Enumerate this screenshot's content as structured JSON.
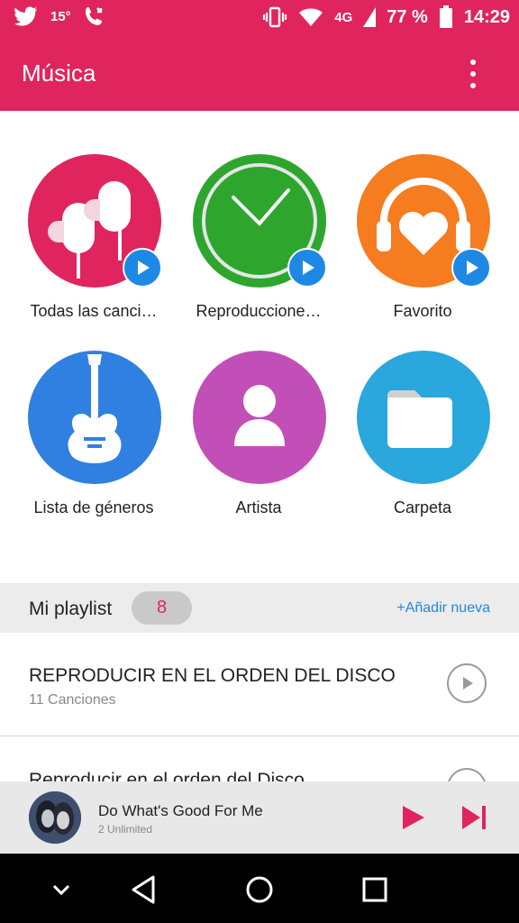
{
  "status_bar": {
    "temperature": "15°",
    "network": "4G",
    "battery": "77 %",
    "time": "14:29",
    "icons": [
      "twitter-icon",
      "phone-call-icon",
      "vibrate-icon",
      "wifi-icon",
      "signal-icon",
      "battery-icon"
    ]
  },
  "app_bar": {
    "title": "Música",
    "menu_icon": "more-vert-icon"
  },
  "categories": [
    {
      "label": "Todas las canci…",
      "icon": "earphones-icon",
      "color": "#e0245e",
      "play_badge": true
    },
    {
      "label": "Reproduccione…",
      "icon": "clock-icon",
      "color": "#2ea62e",
      "play_badge": true
    },
    {
      "label": "Favorito",
      "icon": "heart-headphones-icon",
      "color": "#f57c1f",
      "play_badge": true
    },
    {
      "label": "Lista de géneros",
      "icon": "guitar-icon",
      "color": "#2f80e0",
      "play_badge": false
    },
    {
      "label": "Artista",
      "icon": "person-icon",
      "color": "#c24fb8",
      "play_badge": false
    },
    {
      "label": "Carpeta",
      "icon": "folder-icon",
      "color": "#2aa7dd",
      "play_badge": false
    }
  ],
  "playlist_section": {
    "title": "Mi playlist",
    "count": "8",
    "add_label": "+Añadir nueva"
  },
  "playlists": [
    {
      "title": "REPRODUCIR EN EL ORDEN DEL DISCO",
      "subtitle": "11 Canciones"
    },
    {
      "title": "Reproducir en el orden del Disco",
      "subtitle": ""
    }
  ],
  "now_playing": {
    "title": "Do What's Good For Me",
    "artist": "2 Unlimited"
  },
  "colors": {
    "accent": "#e0245e",
    "link": "#1e88e5"
  }
}
